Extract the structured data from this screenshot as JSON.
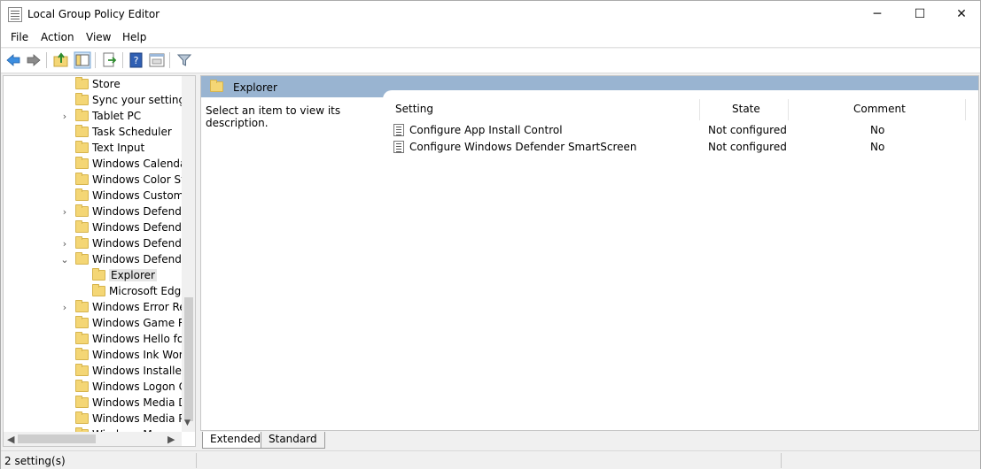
{
  "window": {
    "title": "Local Group Policy Editor",
    "minimize_glyph": "─",
    "maximize_glyph": "☐",
    "close_glyph": "✕"
  },
  "menu": [
    "File",
    "Action",
    "View",
    "Help"
  ],
  "toolbar": {
    "icons": [
      "back-icon",
      "forward-icon",
      "up-folder-icon",
      "show-hide-tree-icon",
      "export-list-icon",
      "help-icon",
      "properties-icon",
      "filter-icon"
    ]
  },
  "tree": {
    "items": [
      {
        "label": "Store",
        "expander": ""
      },
      {
        "label": "Sync your settings",
        "expander": ""
      },
      {
        "label": "Tablet PC",
        "expander": "›"
      },
      {
        "label": "Task Scheduler",
        "expander": ""
      },
      {
        "label": "Text Input",
        "expander": ""
      },
      {
        "label": "Windows Calendar",
        "expander": ""
      },
      {
        "label": "Windows Color Sys",
        "expander": ""
      },
      {
        "label": "Windows Custome",
        "expander": ""
      },
      {
        "label": "Windows Defender",
        "expander": "›"
      },
      {
        "label": "Windows Defender",
        "expander": ""
      },
      {
        "label": "Windows Defender",
        "expander": "›"
      },
      {
        "label": "Windows Defender",
        "expander": "⌄"
      },
      {
        "label": "Explorer",
        "expander": "",
        "child": true,
        "selected": true
      },
      {
        "label": "Microsoft Edge",
        "expander": "",
        "child": true
      },
      {
        "label": "Windows Error Rep",
        "expander": "›"
      },
      {
        "label": "Windows Game Re",
        "expander": ""
      },
      {
        "label": "Windows Hello for",
        "expander": ""
      },
      {
        "label": "Windows Ink Work",
        "expander": ""
      },
      {
        "label": "Windows Installer",
        "expander": ""
      },
      {
        "label": "Windows Logon O",
        "expander": ""
      },
      {
        "label": "Windows Media Di",
        "expander": ""
      },
      {
        "label": "Windows Media Pl",
        "expander": ""
      },
      {
        "label": "Windows M",
        "expander": ""
      }
    ]
  },
  "right": {
    "header_title": "Explorer",
    "description": "Select an item to view its description.",
    "columns": [
      "Setting",
      "State",
      "Comment"
    ],
    "rows": [
      {
        "setting": "Configure App Install Control",
        "state": "Not configured",
        "comment": "No"
      },
      {
        "setting": "Configure Windows Defender SmartScreen",
        "state": "Not configured",
        "comment": "No"
      }
    ]
  },
  "tabs": [
    "Extended",
    "Standard"
  ],
  "status": {
    "text": "2 setting(s)"
  },
  "colors": {
    "header_band": "#99b4d1",
    "folder": "#f4d675"
  }
}
